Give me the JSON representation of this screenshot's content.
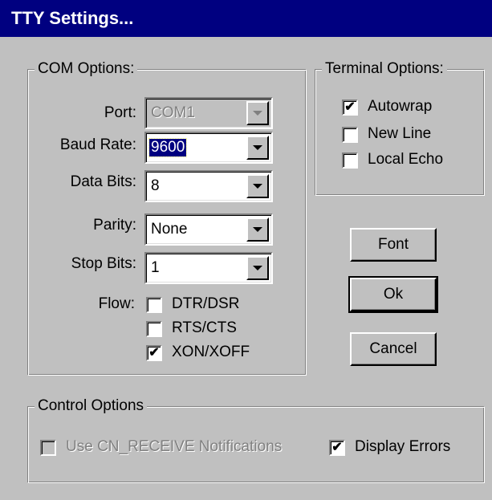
{
  "window": {
    "title": "TTY Settings..."
  },
  "com_options": {
    "legend": "COM Options:",
    "port": {
      "label": "Port:",
      "value": "COM1"
    },
    "baud_rate": {
      "label": "Baud Rate:",
      "value": "9600"
    },
    "data_bits": {
      "label": "Data Bits:",
      "value": "8"
    },
    "parity": {
      "label": "Parity:",
      "value": "None"
    },
    "stop_bits": {
      "label": "Stop Bits:",
      "value": "1"
    },
    "flow": {
      "label": "Flow:",
      "options": [
        {
          "label": "DTR/DSR",
          "checked": false
        },
        {
          "label": "RTS/CTS",
          "checked": false
        },
        {
          "label": "XON/XOFF",
          "checked": true
        }
      ]
    }
  },
  "terminal_options": {
    "legend": "Terminal Options:",
    "options": [
      {
        "label": "Autowrap",
        "checked": true
      },
      {
        "label": "New Line",
        "checked": false
      },
      {
        "label": "Local Echo",
        "checked": false
      }
    ]
  },
  "buttons": {
    "font": "Font",
    "ok": "Ok",
    "cancel": "Cancel"
  },
  "control_options": {
    "legend": "Control Options",
    "use_cn_receive": {
      "label": "Use CN_RECEIVE Notifications",
      "checked": false,
      "enabled": false
    },
    "display_errors": {
      "label": "Display Errors",
      "checked": true
    }
  },
  "colors": {
    "titlebar": "#000080",
    "face": "#c0c0c0",
    "selection": "#000080"
  }
}
